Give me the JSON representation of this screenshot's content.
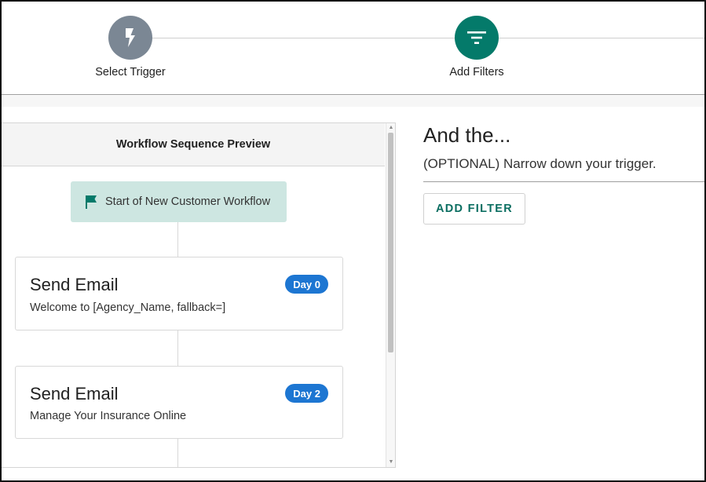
{
  "stepper": {
    "steps": [
      {
        "label": "Select Trigger",
        "icon": "lightning-icon",
        "color": "#7b8794"
      },
      {
        "label": "Add Filters",
        "icon": "filter-icon",
        "color": "#047a6a"
      }
    ]
  },
  "preview": {
    "header": "Workflow Sequence Preview",
    "start_node": {
      "label": "Start of New Customer Workflow",
      "icon": "flag-icon"
    },
    "cards": [
      {
        "title": "Send Email",
        "subtitle": "Welcome to [Agency_Name, fallback=]",
        "badge": "Day 0"
      },
      {
        "title": "Send Email",
        "subtitle": "Manage Your Insurance Online",
        "badge": "Day 2"
      }
    ]
  },
  "filters": {
    "title": "And the...",
    "subtitle": "(OPTIONAL) Narrow down your trigger.",
    "add_button_label": "ADD FILTER"
  },
  "colors": {
    "accent_teal": "#047a6a",
    "badge_blue": "#1d76d2",
    "start_node_bg": "#cde6e1"
  }
}
